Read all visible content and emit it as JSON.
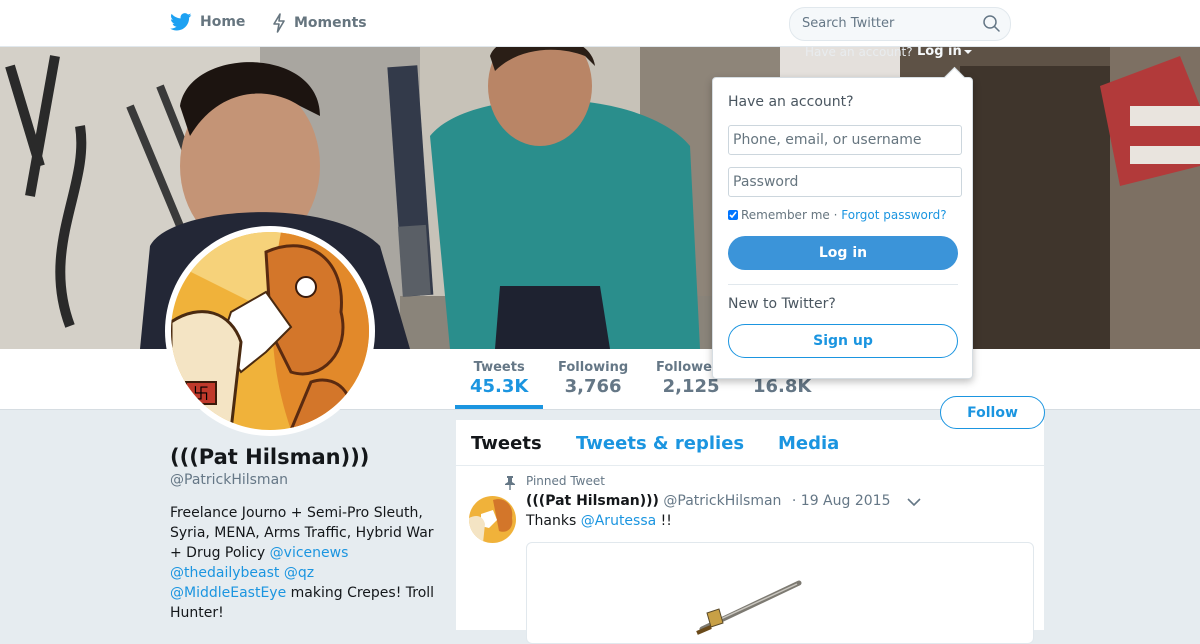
{
  "nav": {
    "home_label": "Home",
    "moments_label": "Moments",
    "search_placeholder": "Search Twitter"
  },
  "profile": {
    "name": "(((Pat Hilsman)))",
    "handle": "@PatrickHilsman",
    "bio": {
      "text1": "Freelance Journo + Semi-Pro Sleuth, Syria, MENA, Arms Traffic, Hybrid War + Drug Policy ",
      "link1": "@vicenews",
      "link2": "@thedailybeast",
      "link3": "@qz",
      "link4": "@MiddleEastEye",
      "text2": " making Crepes! Troll Hunter!"
    },
    "follow_label": "Follow"
  },
  "stats": {
    "tweets_label": "Tweets",
    "tweets_value": "45.3K",
    "following_label": "Following",
    "following_value": "3,766",
    "followers_label": "Followers",
    "followers_value": "2,125",
    "likes_value": "16.8K"
  },
  "timeline": {
    "tabs": [
      "Tweets",
      "Tweets & replies",
      "Media"
    ],
    "pinned_label": "Pinned Tweet",
    "tweet": {
      "name": "(((Pat Hilsman)))",
      "handle": "@PatrickHilsman",
      "dot": "·",
      "date": "19 Aug 2015",
      "text_prefix": "Thanks ",
      "mention": "@Arutessa",
      "text_suffix": " !!"
    }
  },
  "login": {
    "strip_text": "Have an account?",
    "strip_link": "Log in",
    "title": "Have an account?",
    "username_placeholder": "Phone, email, or username",
    "password_placeholder": "Password",
    "remember_label": "Remember me",
    "separator": "·",
    "forgot_label": "Forgot password?",
    "login_button": "Log in",
    "new_label": "New to Twitter?",
    "signup_button": "Sign up"
  },
  "colors": {
    "accent": "#1b95e0",
    "login_button": "#3b94d9",
    "background": "#e6ecf0"
  }
}
